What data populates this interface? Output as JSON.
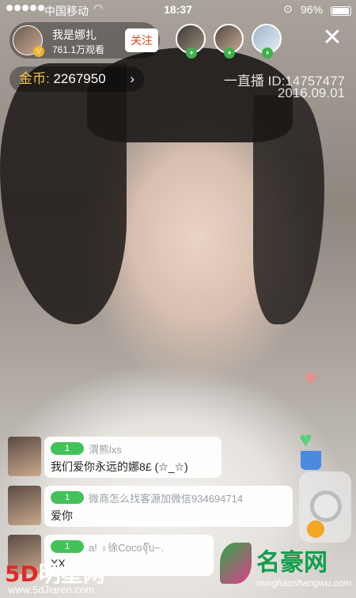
{
  "status_bar": {
    "carrier": "中国移动",
    "time": "18:37",
    "battery_pct": "96%",
    "battery_level": 0.96,
    "icons": [
      "signal-dots-icon",
      "wifi-icon",
      "rotation-lock-icon",
      "battery-icon"
    ]
  },
  "host": {
    "name": "我是娜扎",
    "viewers": "761.1万观看",
    "follow_label": "关注"
  },
  "viewers": [
    {
      "level": "♦"
    },
    {
      "level": "♦"
    },
    {
      "level": "♦"
    }
  ],
  "coins": {
    "label": "金币:",
    "value": "2267950",
    "arrow": "›"
  },
  "watermark": {
    "line1": "一直播 ID:14757477",
    "line2": "2016.09.01"
  },
  "close_label": "✕",
  "chat": [
    {
      "level": "1",
      "username": "渭熊lxs",
      "message": "我们爱你永远的娜8£ (☆_☆)"
    },
    {
      "level": "1",
      "username": "微商怎么找客源加微信934694714",
      "message": "爱你"
    },
    {
      "level": "1",
      "username": "a! ♁徐Cocoจุ๊บ~.",
      "message": "XX"
    }
  ],
  "logos": {
    "left_brand": "5D",
    "left_text": "明星网",
    "left_url": "www.5dJiaren.com",
    "right_brand": "名豪网",
    "right_url": "minghaoshangwu.com"
  },
  "colors": {
    "follow_text": "#e0451f",
    "coin_label": "#f5c542",
    "level_badge": "#44c25a"
  }
}
